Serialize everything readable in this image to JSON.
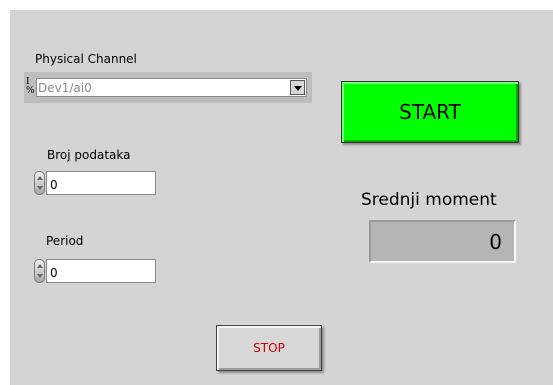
{
  "physical_channel": {
    "label": "Physical Channel",
    "io_icon_top": "I",
    "io_icon_bottom": "%",
    "value": "Dev1/ai0"
  },
  "broj_podataka": {
    "label": "Broj podataka",
    "value": "0"
  },
  "period": {
    "label": "Period",
    "value": "0"
  },
  "start_button": {
    "label": "START",
    "color": "#00ff00"
  },
  "srednji_moment": {
    "label": "Srednji moment",
    "value": "0"
  },
  "stop_button": {
    "label": "STOP",
    "color": "#d00000"
  }
}
